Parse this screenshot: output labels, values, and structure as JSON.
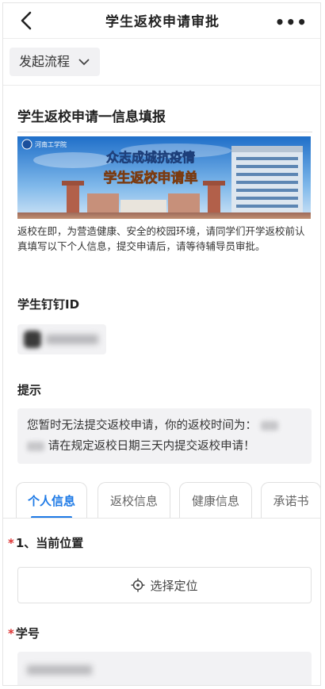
{
  "nav": {
    "title": "学生返校申请审批",
    "more": "•••"
  },
  "flow": {
    "label": "发起流程"
  },
  "form": {
    "heading": "学生返校申请一信息填报",
    "banner": {
      "logo_text": "河南工学院",
      "line1": "众志成城抗疫情",
      "line2": "学生返校申请单"
    },
    "description": "返校在即，为营造健康、安全的校园环境，请同学们开学返校前认真填写以下个人信息，提交申请后，请等待辅导员审批。",
    "dingtalk_label": "学生钉钉ID",
    "tip_label": "提示",
    "tip_part1": "您暂时无法提交返校申请，你的返校时间为：",
    "tip_part2": "请在规定返校日期三天内提交返校申请！"
  },
  "tabs": [
    {
      "label": "个人信息",
      "active": true
    },
    {
      "label": "返校信息",
      "active": false
    },
    {
      "label": "健康信息",
      "active": false
    },
    {
      "label": "承诺书",
      "active": false
    }
  ],
  "fields": {
    "required_mark": "*",
    "location_label": "1、当前位置",
    "location_button": "选择定位",
    "student_id_label": "学号"
  },
  "colors": {
    "accent": "#1e7ae6",
    "required": "#d33333"
  }
}
